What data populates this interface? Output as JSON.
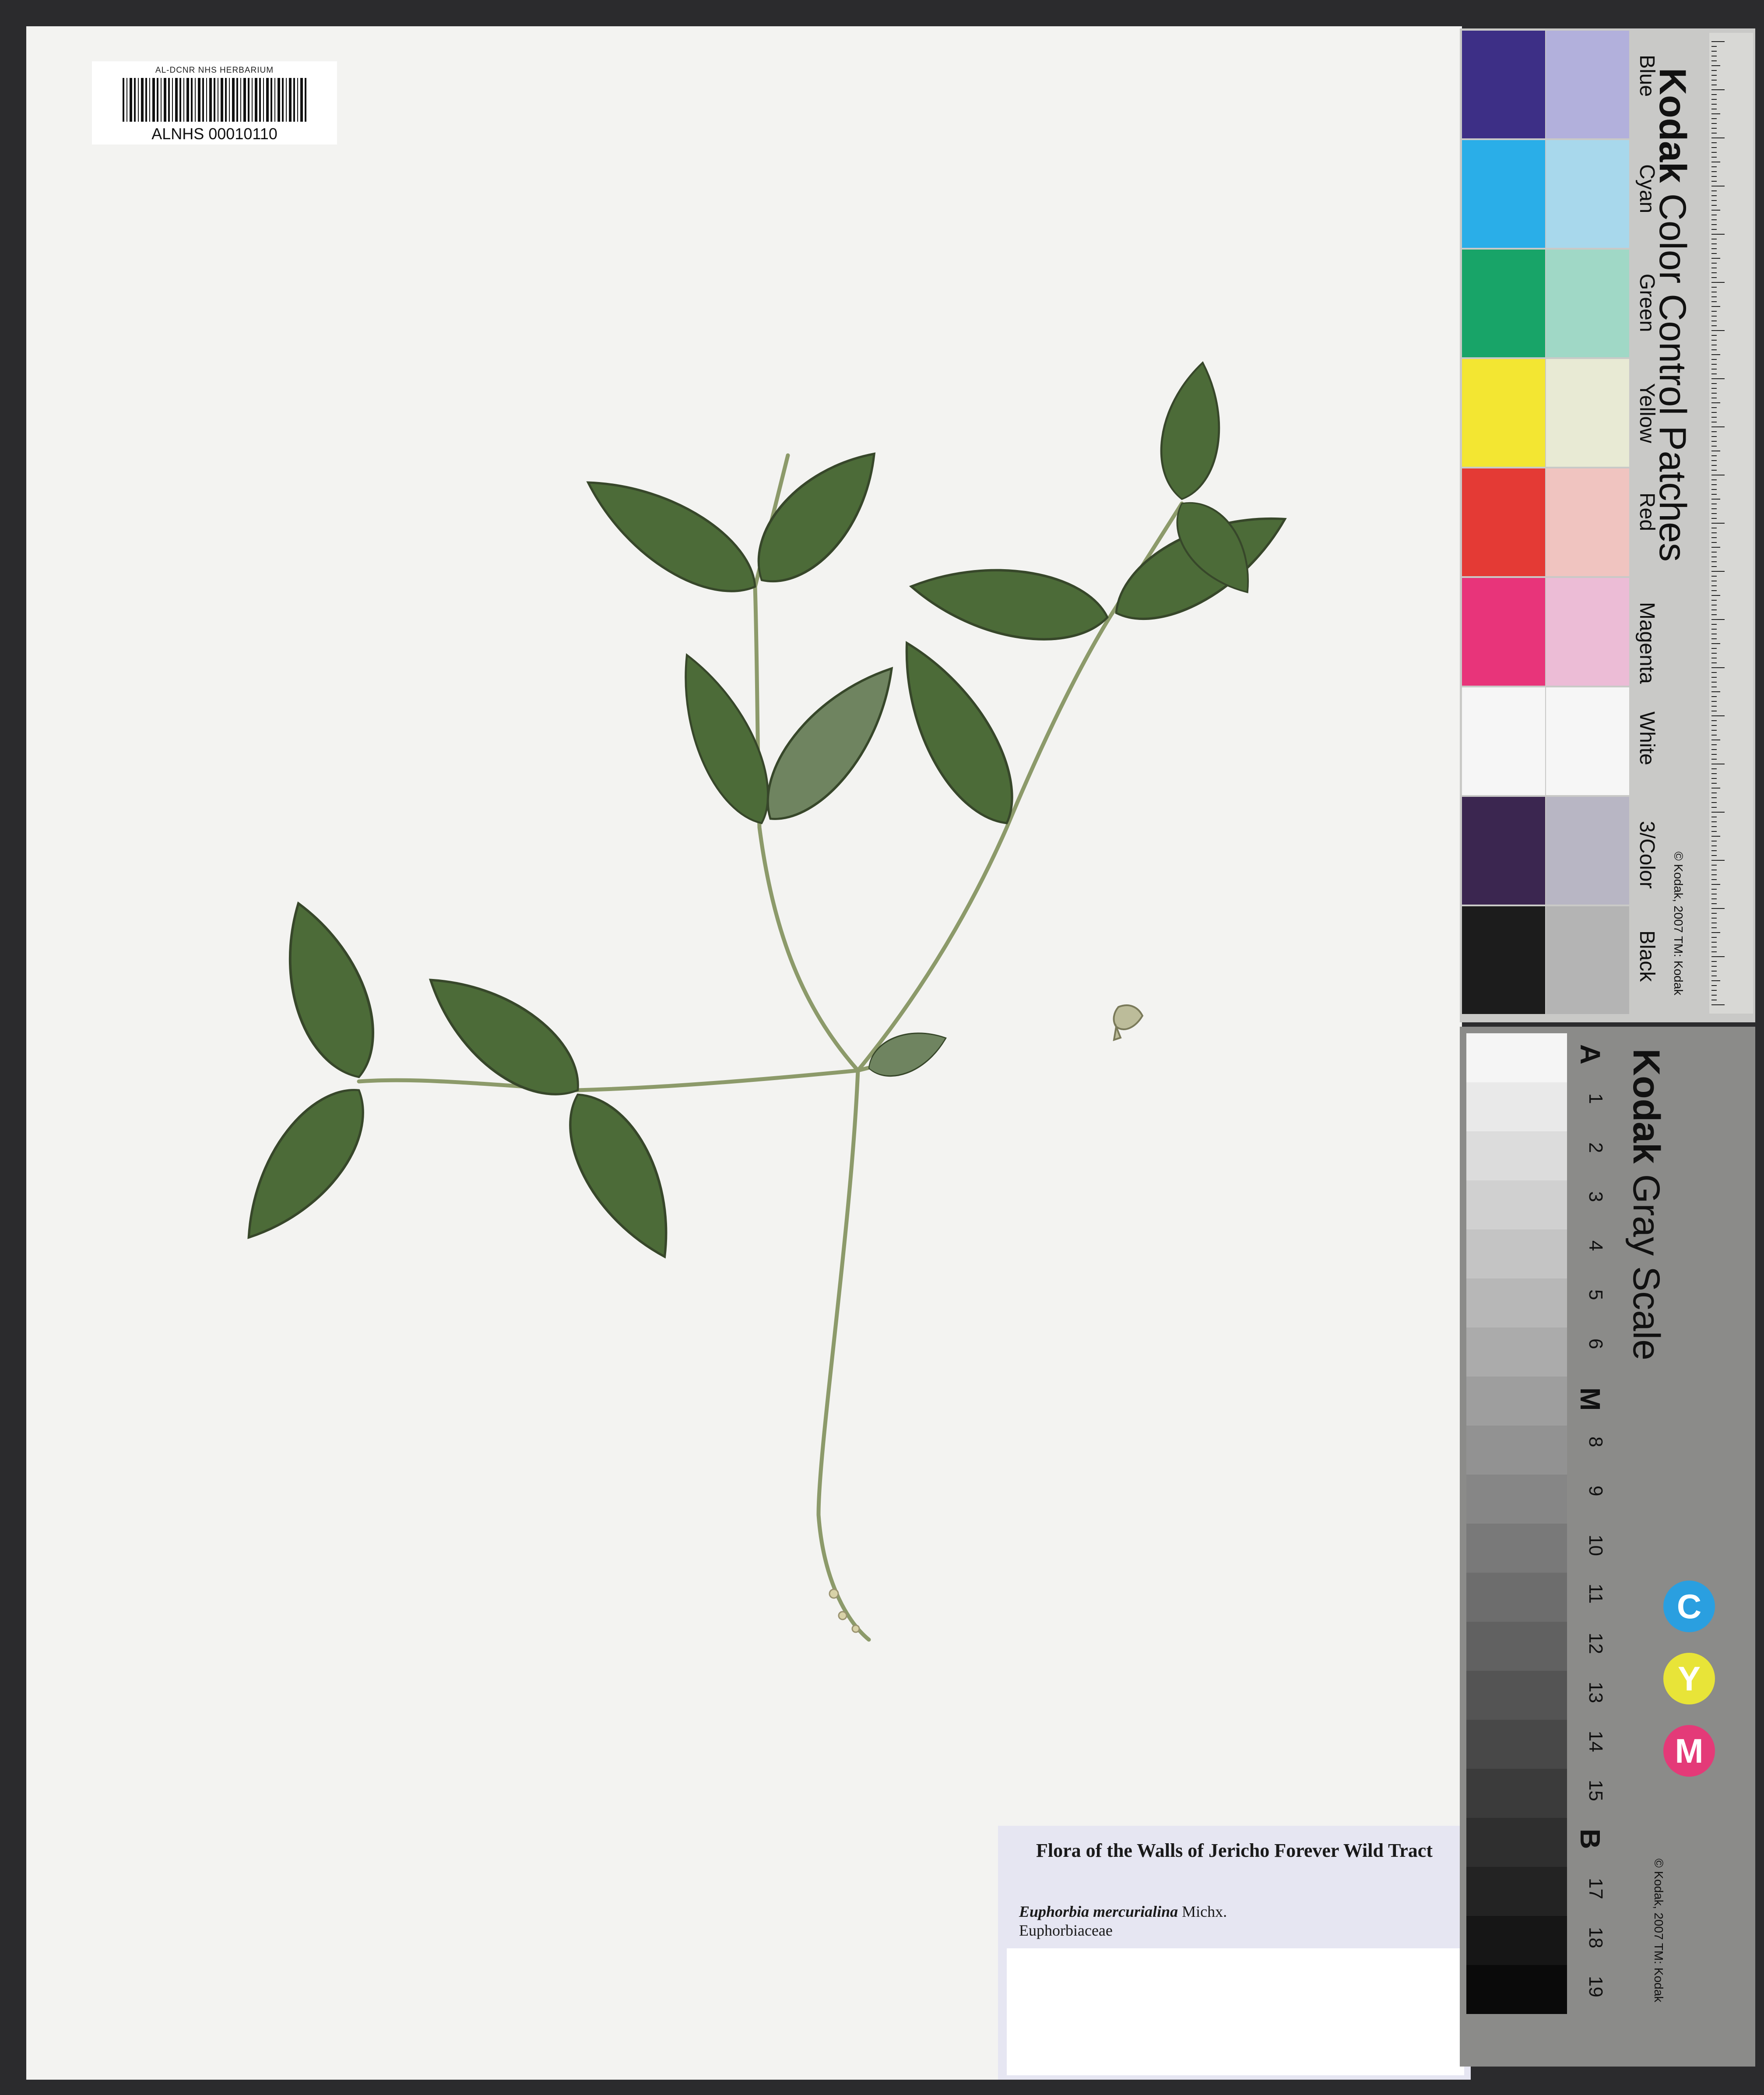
{
  "barcode_label": {
    "institution": "AL-DCNR NHS HERBARIUM",
    "catalog_number": "ALNHS 00010110"
  },
  "herbarium_label": {
    "title": "Flora of the Walls of Jericho Forever Wild Tract",
    "scientific_name": "Euphorbia mercurialina",
    "author": "Michx.",
    "family": "Euphorbiaceae"
  },
  "color_card": {
    "brand": "Kodak",
    "title": "Color Control Patches",
    "patches": [
      {
        "name": "Blue",
        "dark": "#3d2f86",
        "light": "#b2b0dc"
      },
      {
        "name": "Cyan",
        "dark": "#2aaee8",
        "light": "#a8d8ec"
      },
      {
        "name": "Green",
        "dark": "#18a468",
        "light": "#a0d8c6"
      },
      {
        "name": "Yellow",
        "dark": "#f3e632",
        "light": "#e8ead4"
      },
      {
        "name": "Red",
        "dark": "#e43a35",
        "light": "#f0c4c0"
      },
      {
        "name": "Magenta",
        "dark": "#e8347a",
        "light": "#ecbcd6"
      },
      {
        "name": "White",
        "dark": "#f6f6f6",
        "light": "#f6f6f6"
      },
      {
        "name": "3/Color",
        "dark": "#3b2650",
        "light": "#b8b6c4"
      },
      {
        "name": "Black",
        "dark": "#1c1c1c",
        "light": "#b4b4b4"
      }
    ],
    "copyright": "© Kodak, 2007 TM: Kodak",
    "ruler_units": [
      "cm",
      "inches"
    ]
  },
  "gray_card": {
    "brand": "Kodak",
    "title": "Gray Scale",
    "steps": [
      "A",
      "1",
      "2",
      "3",
      "4",
      "5",
      "6",
      "M",
      "8",
      "9",
      "10",
      "11",
      "12",
      "13",
      "14",
      "15",
      "B",
      "17",
      "18",
      "19"
    ],
    "cym": [
      {
        "letter": "C",
        "color": "#2a9fe0"
      },
      {
        "letter": "Y",
        "color": "#e8e438"
      },
      {
        "letter": "M",
        "color": "#e43a78"
      }
    ],
    "copyright": "© Kodak, 2007 TM: Kodak"
  }
}
